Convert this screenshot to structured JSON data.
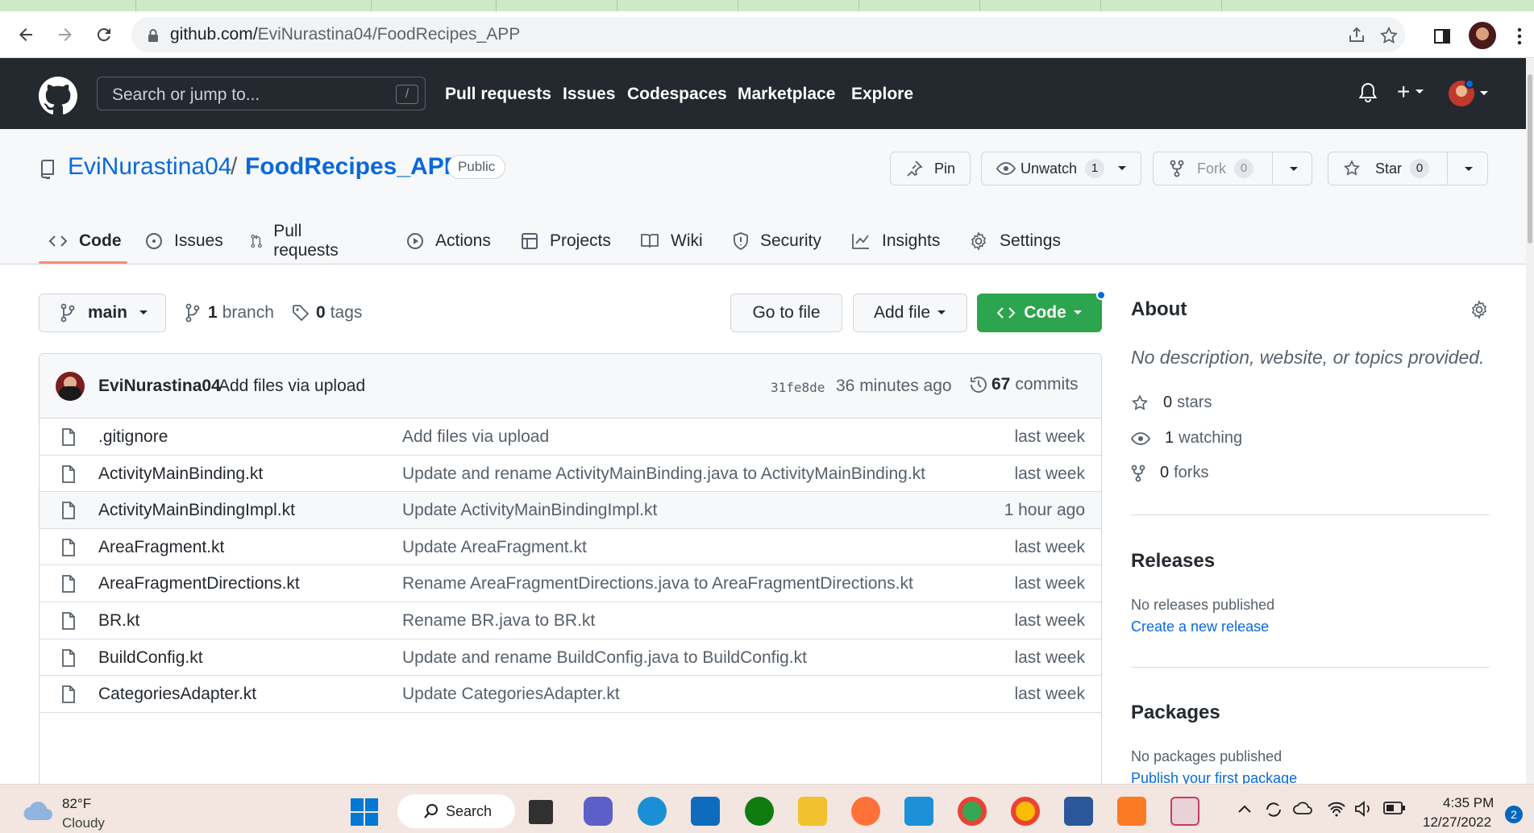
{
  "browser": {
    "url_host": "github.com/",
    "url_path": "EviNurastina04/FoodRecipes_APP"
  },
  "header": {
    "search_placeholder": "Search or jump to...",
    "slash_key": "/",
    "nav": [
      "Pull requests",
      "Issues",
      "Codespaces",
      "Marketplace",
      "Explore"
    ],
    "plus_label": "+"
  },
  "repo": {
    "owner": "EviNurastina04",
    "separator": "/",
    "name": "FoodRecipes_APP",
    "visibility": "Public",
    "pin_label": "Pin",
    "unwatch_label": "Unwatch",
    "watch_count": "1",
    "fork_label": "Fork",
    "fork_count": "0",
    "star_label": "Star",
    "star_count": "0"
  },
  "tabs": [
    "Code",
    "Issues",
    "Pull requests",
    "Actions",
    "Projects",
    "Wiki",
    "Security",
    "Insights",
    "Settings"
  ],
  "toolbar": {
    "branch": "main",
    "branch_count": "1",
    "branch_word": "branch",
    "tag_count": "0",
    "tag_word": "tags",
    "go_to_file": "Go to file",
    "add_file": "Add file",
    "code": "Code"
  },
  "commit": {
    "author": "EviNurastina04",
    "message": "Add files via upload",
    "sha": "31fe8de",
    "time": "36 minutes ago",
    "count": "67",
    "count_word": "commits"
  },
  "files": [
    {
      "name": ".gitignore",
      "message": "Add files via upload",
      "date": "last week"
    },
    {
      "name": "ActivityMainBinding.kt",
      "message": "Update and rename ActivityMainBinding.java to ActivityMainBinding.kt",
      "date": "last week"
    },
    {
      "name": "ActivityMainBindingImpl.kt",
      "message": "Update ActivityMainBindingImpl.kt",
      "date": "1 hour ago"
    },
    {
      "name": "AreaFragment.kt",
      "message": "Update AreaFragment.kt",
      "date": "last week"
    },
    {
      "name": "AreaFragmentDirections.kt",
      "message": "Rename AreaFragmentDirections.java to AreaFragmentDirections.kt",
      "date": "last week"
    },
    {
      "name": "BR.kt",
      "message": "Rename BR.java to BR.kt",
      "date": "last week"
    },
    {
      "name": "BuildConfig.kt",
      "message": "Update and rename BuildConfig.java to BuildConfig.kt",
      "date": "last week"
    },
    {
      "name": "CategoriesAdapter.kt",
      "message": "Update CategoriesAdapter.kt",
      "date": "last week"
    }
  ],
  "sidebar": {
    "about_title": "About",
    "about_desc": "No description, website, or topics provided.",
    "stars_count": "0",
    "stars_word": "stars",
    "watching_count": "1",
    "watching_word": "watching",
    "forks_count": "0",
    "forks_word": "forks",
    "releases_title": "Releases",
    "releases_text": "No releases published",
    "releases_link": "Create a new release",
    "packages_title": "Packages",
    "packages_text": "No packages published",
    "packages_link": "Publish your first package"
  },
  "taskbar": {
    "temp": "82°F",
    "condition": "Cloudy",
    "search": "Search",
    "time": "4:35 PM",
    "date": "12/27/2022",
    "notifications": "2"
  },
  "colors": {
    "header_bg": "#24292f",
    "link": "#0969da",
    "code_button": "#2da44e",
    "active_tab_underline": "#fd8c73"
  }
}
